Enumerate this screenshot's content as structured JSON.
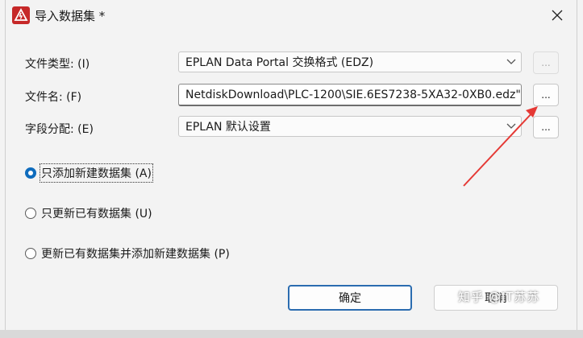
{
  "window": {
    "title": "导入数据集 *",
    "accent": "#c62828"
  },
  "form": {
    "file_type_label": "文件类型: (I)",
    "file_type_value": "EPLAN Data Portal 交换格式 (EDZ)",
    "file_name_label": "文件名: (F)",
    "file_name_value": "NetdiskDownload\\PLC-1200\\SIE.6ES7238-5XA32-0XB0.edz\"",
    "field_mapping_label": "字段分配: (E)",
    "field_mapping_value": "EPLAN 默认设置",
    "browse_label": "..."
  },
  "options": [
    {
      "label": "只添加新建数据集 (A)",
      "checked": true
    },
    {
      "label": "只更新已有数据集 (U)",
      "checked": false
    },
    {
      "label": "更新已有数据集并添加新建数据集 (P)",
      "checked": false
    }
  ],
  "buttons": {
    "ok": "确定",
    "cancel": "取消"
  },
  "watermark": "知乎 @IT苏苏",
  "colors": {
    "primary": "#0f6cbd",
    "arrow": "#e53935"
  }
}
